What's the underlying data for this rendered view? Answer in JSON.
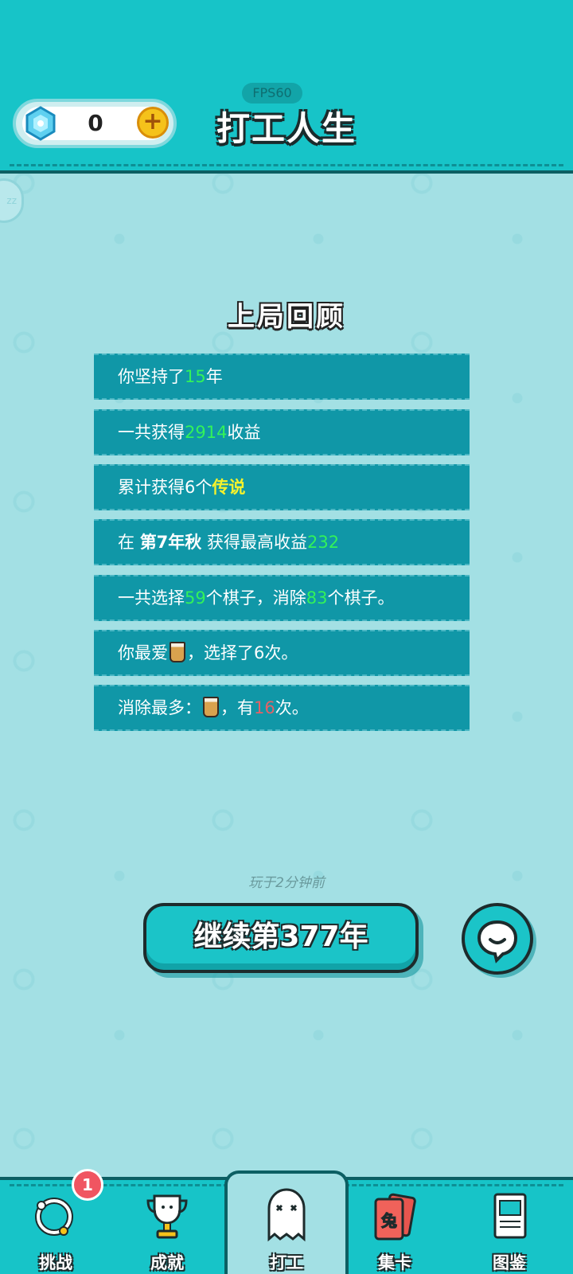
{
  "header": {
    "fps_label": "FPS60",
    "title": "打工人生",
    "gem_count": "0",
    "plus_icon": "plus-icon",
    "side_label": "zz"
  },
  "review": {
    "title": "上局回顾",
    "rows": [
      {
        "parts": [
          {
            "t": "你坚持了"
          },
          {
            "t": "15",
            "c": "g"
          },
          {
            "t": "年"
          }
        ]
      },
      {
        "parts": [
          {
            "t": "一共获得"
          },
          {
            "t": "2914",
            "c": "g"
          },
          {
            "t": "收益"
          }
        ]
      },
      {
        "parts": [
          {
            "t": "累计获得6个"
          },
          {
            "t": "传说",
            "c": "y"
          }
        ]
      },
      {
        "parts": [
          {
            "t": "在 "
          },
          {
            "t": "第7年秋",
            "c": "b"
          },
          {
            "t": " 获得最高收益"
          },
          {
            "t": "232",
            "c": "g"
          }
        ]
      },
      {
        "parts": [
          {
            "t": "一共选择"
          },
          {
            "t": "59",
            "c": "g"
          },
          {
            "t": "个棋子，消除"
          },
          {
            "t": "83",
            "c": "g"
          },
          {
            "t": "个棋子。"
          }
        ]
      },
      {
        "parts": [
          {
            "t": "你最爱"
          },
          {
            "icon": "milk-tea-icon"
          },
          {
            "t": "，选择了6次。"
          }
        ]
      },
      {
        "parts": [
          {
            "t": "消除最多："
          },
          {
            "icon": "milk-tea-icon"
          },
          {
            "t": "，有"
          },
          {
            "t": "16",
            "c": "r"
          },
          {
            "t": "次。"
          }
        ]
      }
    ]
  },
  "played_ago": "玩于2分钟前",
  "continue_label": "继续第377年",
  "nav": {
    "items": [
      {
        "label": "挑战",
        "icon": "challenge-ring-icon",
        "badge": "1"
      },
      {
        "label": "成就",
        "icon": "trophy-icon"
      },
      {
        "label": "打工",
        "icon": "ghost-icon"
      },
      {
        "label": "集卡",
        "icon": "rabbit-card-icon",
        "card_text": "兔"
      },
      {
        "label": "图鉴",
        "icon": "book-icon"
      }
    ]
  },
  "colors": {
    "header": "#17c4c8",
    "row_bg": "#1097a7",
    "highlight_green": "#32f25a",
    "highlight_yellow": "#f5f22c",
    "highlight_red": "#e46266"
  }
}
